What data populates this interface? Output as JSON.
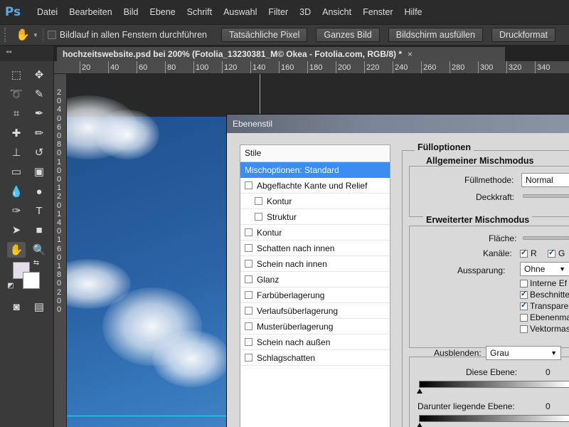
{
  "app": {
    "logo": "Ps"
  },
  "menu": [
    "Datei",
    "Bearbeiten",
    "Bild",
    "Ebene",
    "Schrift",
    "Auswahl",
    "Filter",
    "3D",
    "Ansicht",
    "Fenster",
    "Hilfe"
  ],
  "options": {
    "hand_icon": "✋",
    "scroll_all_label": "Bildlauf in allen Fenstern durchführen",
    "buttons": [
      "Tatsächliche Pixel",
      "Ganzes Bild",
      "Bildschirm ausfüllen",
      "Druckformat"
    ]
  },
  "document": {
    "tab_title": "hochzeitswebsite.psd bei 200% (Fotolia_13230381_M© Okea - Fotolia.com, RGB/8) *",
    "close": "×"
  },
  "tools_header": "◂◂",
  "ruler": {
    "top": [
      "20",
      "40",
      "60",
      "80",
      "100",
      "120",
      "140",
      "160",
      "180",
      "200",
      "220",
      "240",
      "260",
      "280",
      "300",
      "320",
      "340"
    ],
    "left": [
      "2",
      "0",
      "4",
      "0",
      "6",
      "0",
      "8",
      "0",
      "1",
      "0",
      "0",
      "1",
      "2",
      "0",
      "1",
      "4",
      "0",
      "1",
      "6",
      "0",
      "1",
      "8",
      "0",
      "2",
      "0",
      "0"
    ]
  },
  "dialog": {
    "title": "Ebenenstil",
    "styles_header": "Stile",
    "styles": [
      {
        "label": "Mischoptionen: Standard",
        "selected": true,
        "checkbox": false,
        "sub": false
      },
      {
        "label": "Abgeflachte Kante und Relief",
        "selected": false,
        "checkbox": true,
        "sub": false
      },
      {
        "label": "Kontur",
        "selected": false,
        "checkbox": true,
        "sub": true
      },
      {
        "label": "Struktur",
        "selected": false,
        "checkbox": true,
        "sub": true
      },
      {
        "label": "Kontur",
        "selected": false,
        "checkbox": true,
        "sub": false
      },
      {
        "label": "Schatten nach innen",
        "selected": false,
        "checkbox": true,
        "sub": false
      },
      {
        "label": "Schein nach innen",
        "selected": false,
        "checkbox": true,
        "sub": false
      },
      {
        "label": "Glanz",
        "selected": false,
        "checkbox": true,
        "sub": false
      },
      {
        "label": "Farbüberlagerung",
        "selected": false,
        "checkbox": true,
        "sub": false
      },
      {
        "label": "Verlaufsüberlagerung",
        "selected": false,
        "checkbox": true,
        "sub": false
      },
      {
        "label": "Musterüberlagerung",
        "selected": false,
        "checkbox": true,
        "sub": false
      },
      {
        "label": "Schein nach außen",
        "selected": false,
        "checkbox": true,
        "sub": false
      },
      {
        "label": "Schlagschatten",
        "selected": false,
        "checkbox": true,
        "sub": false
      }
    ],
    "fill_options_title": "Fülloptionen",
    "general_title": "Allgemeiner Mischmodus",
    "fill_method_label": "Füllmethode:",
    "fill_method_value": "Normal",
    "opacity_label": "Deckkraft:",
    "advanced_title": "Erweiterter Mischmodus",
    "area_label": "Fläche:",
    "channels_label": "Kanäle:",
    "channel_r": "R",
    "channel_g": "G",
    "knockout_label": "Aussparung:",
    "knockout_value": "Ohne",
    "adv_checks": [
      {
        "label": "Interne Ef",
        "checked": false
      },
      {
        "label": "Beschnitte",
        "checked": true
      },
      {
        "label": "Transpare",
        "checked": true
      },
      {
        "label": "Ebenenma",
        "checked": false
      },
      {
        "label": "Vektormas",
        "checked": false
      }
    ],
    "blend_if_label": "Ausblenden:",
    "blend_if_value": "Grau",
    "this_layer_label": "Diese Ebene:",
    "this_layer_value": "0",
    "underlying_label": "Darunter liegende Ebene:",
    "underlying_value": "0"
  }
}
